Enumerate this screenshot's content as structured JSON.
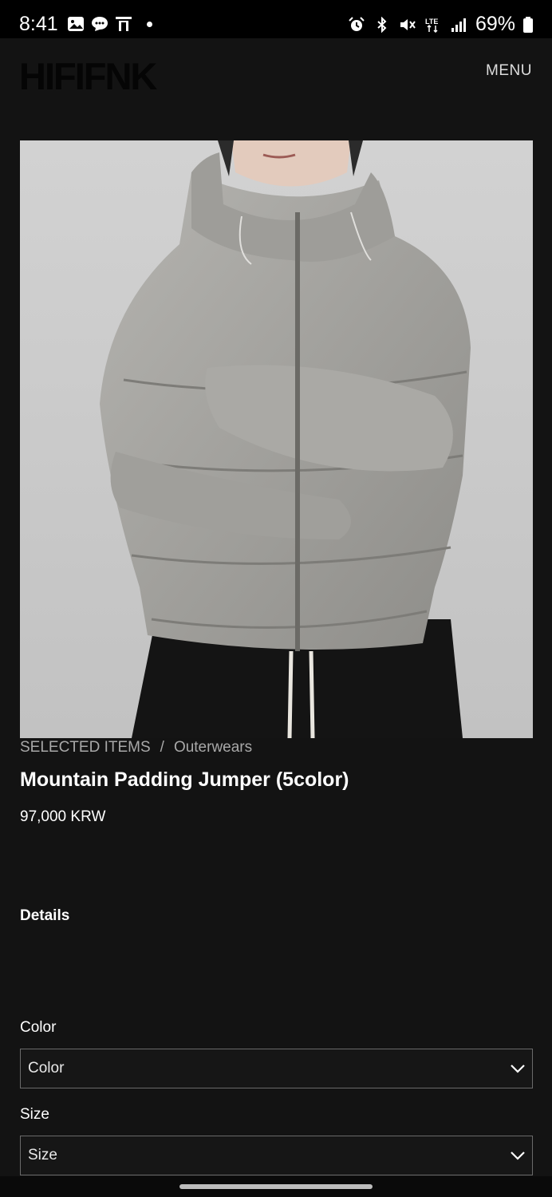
{
  "status_bar": {
    "time": "8:41",
    "battery": "69%",
    "left_icons": [
      "gallery-icon",
      "chat-icon",
      "t-app-icon",
      "dot-icon"
    ],
    "right_icons": [
      "alarm-icon",
      "bluetooth-icon",
      "mute-icon",
      "lte-icon",
      "signal-icon",
      "battery-icon"
    ]
  },
  "header": {
    "logo": "HIFIFNK",
    "menu_label": "MENU"
  },
  "product": {
    "breadcrumb": [
      "SELECTED ITEMS",
      "/",
      "Outerwears"
    ],
    "title": "Mountain Padding Jumper (5color)",
    "price": "97,000 KRW",
    "details_heading": "Details"
  },
  "options": {
    "color_label": "Color",
    "color_value": "Color",
    "size_label": "Size",
    "size_value": "Size"
  },
  "colors": {
    "background": "#131313",
    "status_bar": "#000000",
    "jacket": "#a3a29e",
    "photo_bg": "#c9c9c9"
  }
}
